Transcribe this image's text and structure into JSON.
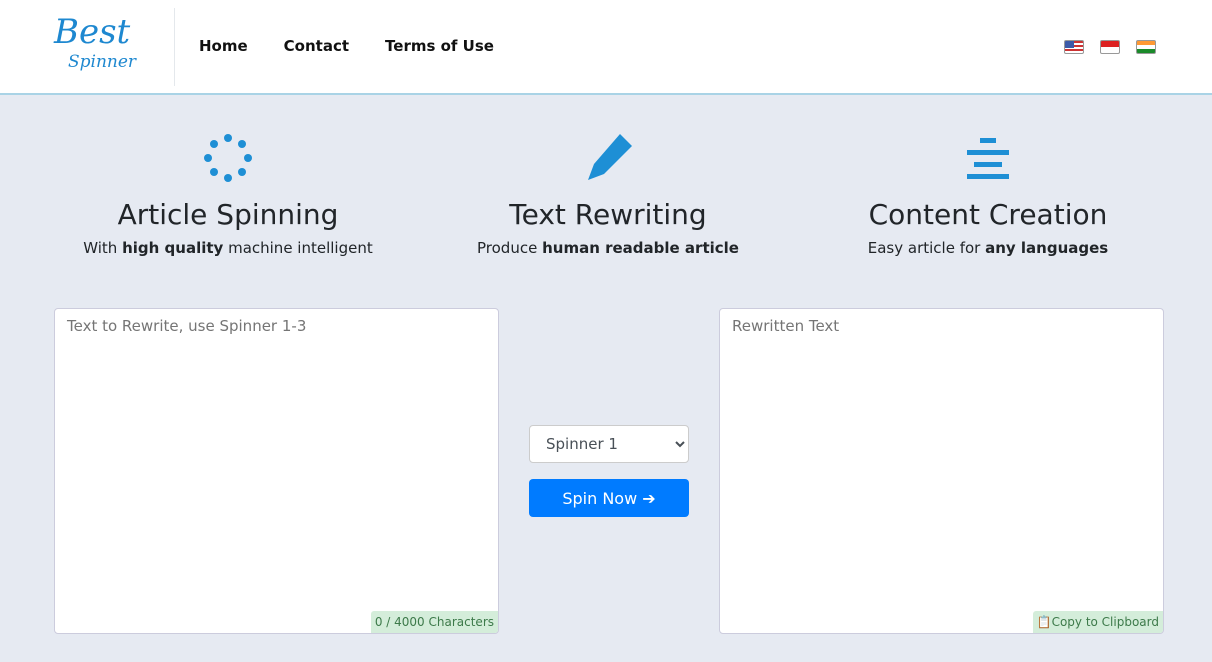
{
  "brand": {
    "logo_text_1": "Best",
    "logo_text_2": "Spinner"
  },
  "nav": {
    "links": [
      "Home",
      "Contact",
      "Terms of Use"
    ],
    "flags": [
      "us-flag",
      "indonesia-flag",
      "india-flag"
    ]
  },
  "features": [
    {
      "icon": "spinner-icon",
      "title": "Article Spinning",
      "pre": "With ",
      "bold": "high quality",
      "post": " machine intelligent"
    },
    {
      "icon": "pen-icon",
      "title": "Text Rewriting",
      "pre": "Produce ",
      "bold": "human readable article",
      "post": ""
    },
    {
      "icon": "align-center-icon",
      "title": "Content Creation",
      "pre": "Easy article for ",
      "bold": "any languages",
      "post": ""
    }
  ],
  "input": {
    "placeholder": "Text to Rewrite, use Spinner 1-3",
    "counter": "0 / 4000 Characters"
  },
  "output": {
    "placeholder": "Rewritten Text",
    "copy_label": "Copy to Clipboard"
  },
  "spinner_select": {
    "selected": "Spinner 1"
  },
  "spin_button": "Spin Now ➔",
  "colors": {
    "accent": "#007bff",
    "icon": "#1e8fd5"
  }
}
